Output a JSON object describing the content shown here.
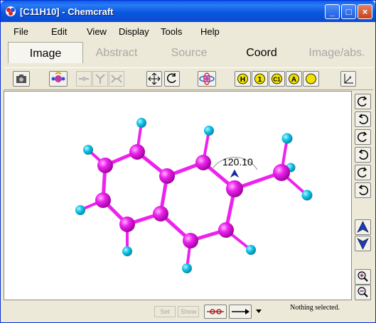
{
  "window": {
    "title": "[C11H10] - Chemcraft",
    "controls": {
      "minimize": "_",
      "maximize": "□",
      "close": "×"
    }
  },
  "menu": [
    "File",
    "Edit",
    "View",
    "Display",
    "Tools",
    "Help"
  ],
  "tabs": [
    {
      "label": "Image",
      "state": "active"
    },
    {
      "label": "Abstract",
      "state": "disabled"
    },
    {
      "label": "Source",
      "state": "disabled"
    },
    {
      "label": "Coord",
      "state": "enabled"
    },
    {
      "label": "Image/abs.",
      "state": "disabled"
    }
  ],
  "toolbar": {
    "label_buttons": [
      "H",
      "1",
      "C1",
      "A"
    ]
  },
  "molecule": {
    "formula": "C11H10",
    "measurement_label": "120.10",
    "atom_colors": {
      "carbon": "#ee22ee",
      "hydrogen": "#11c6e8"
    }
  },
  "statusbar": {
    "set_label": "Set",
    "show_label": "Show",
    "status_text": "Nothing selected."
  },
  "icons": [
    "camera-icon",
    "rotate-molecule-icon",
    "bond-tool-icon",
    "fit-view-icon",
    "rotate-view-icon",
    "orbital-icon",
    "axes-icon",
    "zoom-in-icon",
    "zoom-out-icon",
    "move-up-icon",
    "move-down-icon"
  ]
}
